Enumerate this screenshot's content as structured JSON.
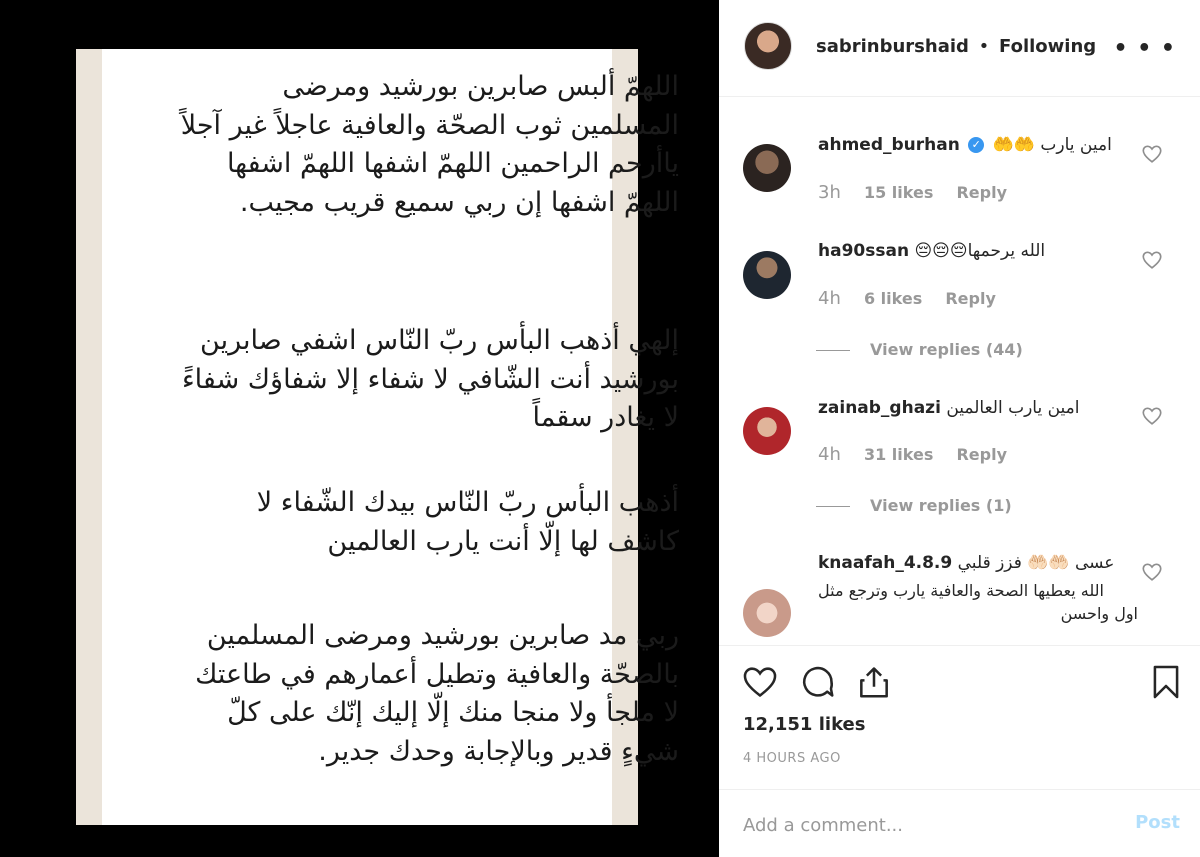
{
  "post_image": {
    "paragraphs": [
      "اللهمّ ألبس صابرين بورشيد ومرضى المسلمين ثوب الصحّة والعافية عاجلاً غير آجلاً ياأرحم الراحمين اللهمّ اشفها اللهمّ اشفها اللهمّ اشفها إن ربي سميع قريب مجيب.",
      "إلهي أذهب البأس ربّ النّاس اشفي صابرين بورشيد أنت الشّافي لا شفاء إلا شفاؤك شفاءً لا يغادر سقماً",
      "أذهب البأس ربّ النّاس بيدك الشّفاء لا كاشف لها إلّا أنت يارب العالمين",
      "ربي مد صابرين بورشيد ومرضى المسلمين بالصحّة والعافية وتطيل أعمارهم في طاعتك لا ملجأ ولا منجا منك إلّا إليك إنّك على كلّ شيءٍ قدير وبالإجابة وحدك جدير."
    ]
  },
  "header": {
    "username": "sabrinburshaid",
    "separator": "•",
    "follow_status": "Following",
    "more_icon": "more-horizontal-icon"
  },
  "comments": [
    {
      "username": "ahmed_burhan",
      "verified": true,
      "text": "امين يارب 🤲🤲",
      "time": "3h",
      "likes": "15 likes",
      "reply": "Reply"
    },
    {
      "username": "ha90ssan",
      "text": "الله يرحمها😔😔😔",
      "time": "4h",
      "likes": "6 likes",
      "reply": "Reply",
      "view_replies": "View replies (44)"
    },
    {
      "username": "zainab_ghazi",
      "text": "امين يارب العالمين",
      "time": "4h",
      "likes": "31 likes",
      "reply": "Reply",
      "view_replies": "View replies (1)"
    },
    {
      "username": "knaafah_4.8.9",
      "text": "عسى 🤲🏻🤲🏻 فزز قلبي",
      "text_line2": "الله يعطيها الصحة والعافية يارب وترجع مثل",
      "text_line3": "اول واحسن"
    }
  ],
  "actions": {
    "likes": "12,151 likes",
    "time_ago": "4 HOURS AGO"
  },
  "add_comment": {
    "placeholder": "Add a comment...",
    "post_label": "Post"
  }
}
